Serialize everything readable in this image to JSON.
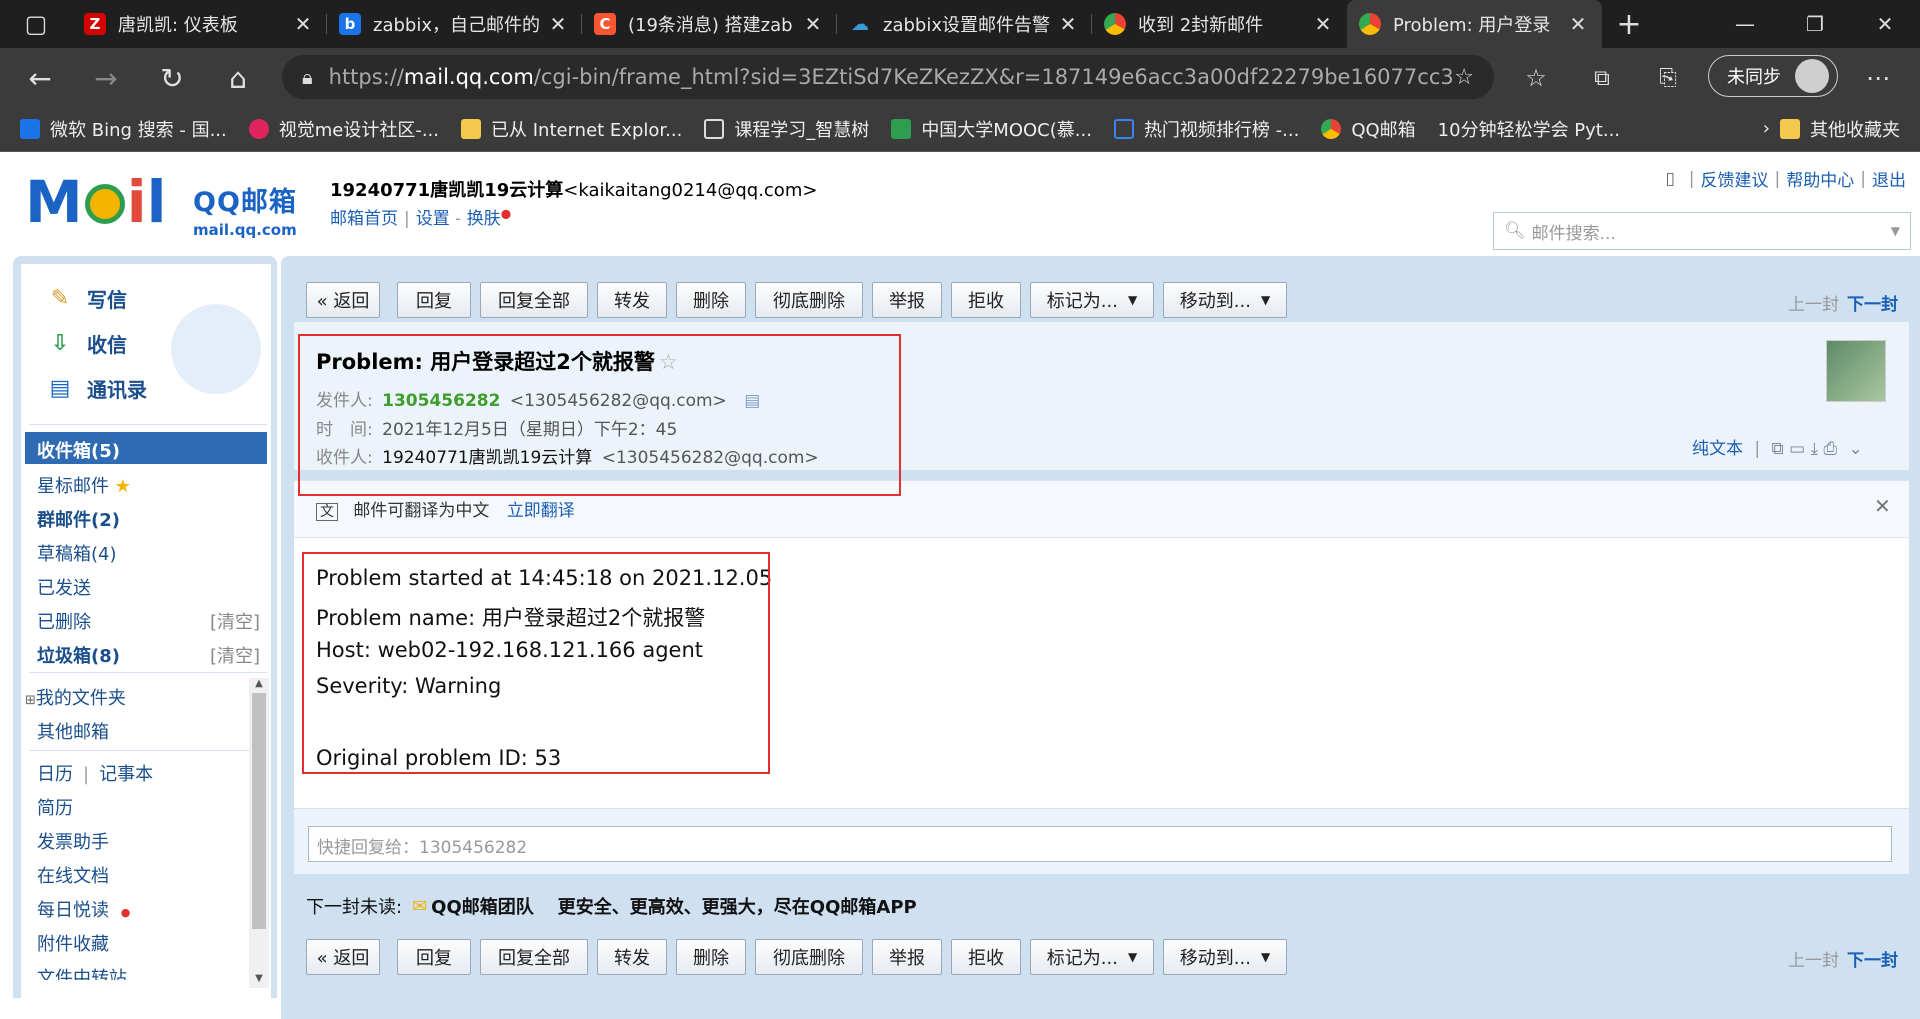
{
  "browser": {
    "tabs": [
      {
        "title": "唐凯凯: 仪表板",
        "icon": "Z",
        "icon_color": "#d40000"
      },
      {
        "title": "zabbix，自己邮件的",
        "icon": "b",
        "icon_color": "#1a73e8"
      },
      {
        "title": "(19条消息) 搭建zab",
        "icon": "C",
        "icon_color": "#fc5531"
      },
      {
        "title": "zabbix设置邮件告警",
        "icon": "cloud",
        "icon_color": "#3a9bdc"
      },
      {
        "title": "收到 2封新邮件",
        "icon": "qq",
        "icon_color": "#f4b400"
      },
      {
        "title": "Problem: 用户登录",
        "icon": "qq",
        "icon_color": "#f4b400"
      }
    ],
    "url_prefix": "https://",
    "url_host": "mail.qq.com",
    "url_rest": "/cgi-bin/frame_html?sid=3EZtiSd7KeZKezZX&r=187149e6acc3a00df22279be16077cc3",
    "sync_label": "未同步",
    "bookmarks": [
      {
        "label": "微软 Bing 搜索 - 国...",
        "color": "#1a73e8"
      },
      {
        "label": "视觉me设计社区-...",
        "color": "#e0245e"
      },
      {
        "label": "已从 Internet Explor...",
        "color": "#f2c94c"
      },
      {
        "label": "课程学习_智慧树",
        "color": "#dddddd"
      },
      {
        "label": "中国大学MOOC(慕...",
        "color": "#2e9d4f"
      },
      {
        "label": "热门视频排行榜 -...",
        "color": "#3b82f6"
      },
      {
        "label": "QQ邮箱",
        "color": "#f4b400"
      },
      {
        "label": "10分钟轻松学会 Pyt...",
        "color": "#3b3b3b"
      }
    ],
    "bookmarks_other": "其他收藏夹"
  },
  "header": {
    "logo_text": "QQ邮箱",
    "logo_sub": "mail.qq.com",
    "user_name": "19240771唐凯凯19云计算",
    "user_email": "<kaikaitang0214@qq.com>",
    "links": [
      "邮箱首页",
      "设置",
      "换肤"
    ],
    "top_links": [
      "反馈建议",
      "帮助中心",
      "退出"
    ],
    "search_placeholder": "邮件搜索..."
  },
  "sidebar": {
    "actions": [
      {
        "label": "写信",
        "icon": "write-icon"
      },
      {
        "label": "收信",
        "icon": "receive-icon"
      },
      {
        "label": "通讯录",
        "icon": "contacts-icon"
      }
    ],
    "folders": [
      {
        "label": "收件箱(5)",
        "bold": true,
        "selected": true
      },
      {
        "label": "星标邮件",
        "star": true
      },
      {
        "label": "群邮件(2)",
        "bold": true
      },
      {
        "label": "草稿箱(4)"
      },
      {
        "label": "已发送"
      },
      {
        "label": "已删除",
        "action": "[清空]"
      },
      {
        "label": "垃圾箱(8)",
        "bold": true,
        "action": "[清空]"
      }
    ],
    "my_folders": "我的文件夹",
    "other_mailbox": "其他邮箱",
    "tools": [
      "日历",
      "记事本",
      "简历",
      "发票助手",
      "在线文档",
      "每日悦读",
      "附件收藏",
      "文件中转站"
    ]
  },
  "toolbar": {
    "buttons": [
      "« 返回",
      "回复",
      "回复全部",
      "转发",
      "删除",
      "彻底删除",
      "举报",
      "拒收"
    ],
    "dropdowns": [
      "标记为...",
      "移动到..."
    ],
    "prev": "上一封",
    "next": "下一封"
  },
  "email": {
    "subject": "Problem: 用户登录超过2个就报警",
    "from_label": "发件人:",
    "from_name": "1305456282",
    "from_email": "<1305456282@qq.com>",
    "time_label": "时　间:",
    "time_value": "2021年12月5日（星期日）下午2：45",
    "to_label": "收件人:",
    "to_name": "19240771唐凯凯19云计算",
    "to_email": "<1305456282@qq.com>",
    "plain_text": "纯文本",
    "translate_text": "邮件可翻译为中文",
    "translate_link": "立即翻译",
    "body": [
      "Problem started at 14:45:18 on 2021.12.05",
      "Problem name: 用户登录超过2个就报警",
      "Host: web02-192.168.121.166 agent",
      "Severity: Warning",
      "",
      "Original problem ID: 53"
    ]
  },
  "reply": {
    "placeholder": "快捷回复给：1305456282"
  },
  "next_unread": {
    "label": "下一封未读:",
    "sender": "QQ邮箱团队",
    "subject": "更安全、更高效、更强大，尽在QQ邮箱APP"
  }
}
